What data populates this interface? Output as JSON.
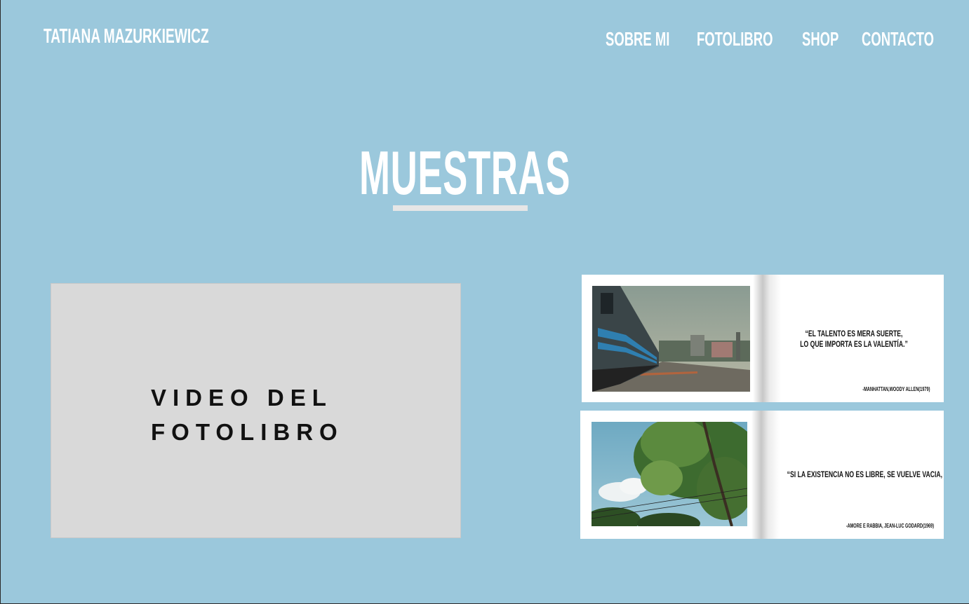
{
  "header": {
    "brand": "TATIANA MAZURKIEWICZ",
    "nav": [
      "SOBRE MI",
      "FOTOLIBRO",
      "SHOP",
      "CONTACTO"
    ]
  },
  "main": {
    "title": "MUESTRAS",
    "video_box": {
      "line1": "VIDEO DEL",
      "line2": "FOTOLIBRO"
    },
    "spreads": [
      {
        "photo": "train-tracks-photo",
        "quote_line1": "“EL TALENTO ES MERA SUERTE,",
        "quote_line2": "LO QUE IMPORTA ES LA VALENTÍA.”",
        "credit": "-MANHATTAN,WOODY ALLEN(1979)"
      },
      {
        "photo": "tree-canopy-photo",
        "quote_line1": "“SI LA EXISTENCIA NO ES LIBRE, SE VUELVE VACIA, O NEUTRAL.”",
        "quote_line2": "",
        "credit": "-AMORE E RABBIA, JEAN-LUC GODARD(1969)"
      }
    ]
  },
  "colors": {
    "background": "#9bc8dc",
    "text_light": "#ffffff",
    "underline": "#e6e6e6",
    "video_box": "#d9d9d9"
  }
}
